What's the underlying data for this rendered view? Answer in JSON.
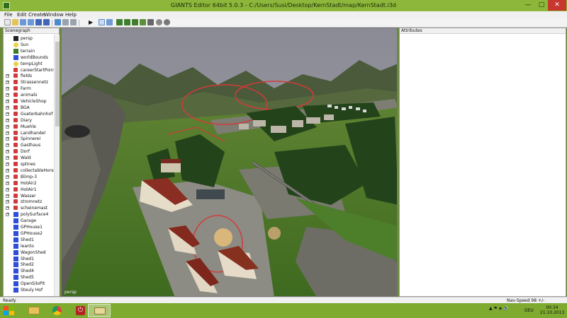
{
  "window": {
    "title": "GIANTS Editor 64bit 5.0.3 - C:/Users/Susi/Desktop/KernStadt/map/KernStadt.i3d",
    "minimize": "—",
    "maximize": "□",
    "close": "✕"
  },
  "menu": [
    "File",
    "Edit",
    "Create",
    "Window",
    "Help"
  ],
  "toolbar": {
    "icons": [
      "new-icon",
      "open-icon",
      "import-icon",
      "export-icon",
      "save-icon",
      "save-as-icon",
      "undo-icon",
      "redo-icon",
      "play-icon",
      "select-icon",
      "move-icon",
      "terrain-sculpt-icon",
      "terrain-paint-icon",
      "foliage-paint-icon",
      "cut-icon",
      "settings-icon",
      "camera-icon"
    ]
  },
  "scenegraph": {
    "title": "Scenegraph",
    "items": [
      {
        "label": "persp",
        "icon": "camera-icon",
        "expandable": false,
        "color": "#222222"
      },
      {
        "label": "Sun",
        "icon": "light-icon",
        "expandable": false,
        "color": "#e8d24a"
      },
      {
        "label": "terrain",
        "icon": "terrain-icon",
        "expandable": false,
        "color": "#3d7a2a"
      },
      {
        "label": "worldBounds",
        "icon": "shape-icon",
        "expandable": false,
        "color": "#2d4ed8"
      },
      {
        "label": "tempLight",
        "icon": "light-icon",
        "expandable": false,
        "color": "#e8d24a"
      },
      {
        "label": "careerStartPoint",
        "icon": "transform-icon",
        "expandable": false,
        "color": "#d23a3a"
      },
      {
        "label": "fields",
        "icon": "transform-icon",
        "expandable": true,
        "color": "#d23a3a"
      },
      {
        "label": "Strassennetz",
        "icon": "transform-icon",
        "expandable": true,
        "color": "#d23a3a"
      },
      {
        "label": "Farm",
        "icon": "transform-icon",
        "expandable": true,
        "color": "#d23a3a"
      },
      {
        "label": "animals",
        "icon": "transform-icon",
        "expandable": true,
        "color": "#d23a3a"
      },
      {
        "label": "VehicleShop",
        "icon": "transform-icon",
        "expandable": true,
        "color": "#d23a3a"
      },
      {
        "label": "BGA",
        "icon": "transform-icon",
        "expandable": true,
        "color": "#d23a3a"
      },
      {
        "label": "Gueterbahnhof",
        "icon": "transform-icon",
        "expandable": true,
        "color": "#d23a3a"
      },
      {
        "label": "Diary",
        "icon": "transform-icon",
        "expandable": true,
        "color": "#d23a3a"
      },
      {
        "label": "Muehle",
        "icon": "transform-icon",
        "expandable": true,
        "color": "#d23a3a"
      },
      {
        "label": "Landhandel",
        "icon": "transform-icon",
        "expandable": true,
        "color": "#d23a3a"
      },
      {
        "label": "Spinnerei",
        "icon": "transform-icon",
        "expandable": true,
        "color": "#d23a3a"
      },
      {
        "label": "Gasthaus",
        "icon": "transform-icon",
        "expandable": true,
        "color": "#d23a3a"
      },
      {
        "label": "Dorf",
        "icon": "transform-icon",
        "expandable": true,
        "color": "#d23a3a"
      },
      {
        "label": "Wald",
        "icon": "transform-icon",
        "expandable": true,
        "color": "#d23a3a"
      },
      {
        "label": "splines",
        "icon": "transform-icon",
        "expandable": true,
        "color": "#d23a3a"
      },
      {
        "label": "collectableHorses",
        "icon": "transform-icon",
        "expandable": true,
        "color": "#d23a3a"
      },
      {
        "label": "Blimp-3",
        "icon": "transform-icon",
        "expandable": true,
        "color": "#d23a3a"
      },
      {
        "label": "HotAir2",
        "icon": "transform-icon",
        "expandable": true,
        "color": "#d23a3a"
      },
      {
        "label": "HotAir1",
        "icon": "transform-icon",
        "expandable": true,
        "color": "#d23a3a"
      },
      {
        "label": "Wasser",
        "icon": "transform-icon",
        "expandable": true,
        "color": "#d23a3a"
      },
      {
        "label": "stromnetz",
        "icon": "transform-icon",
        "expandable": true,
        "color": "#d23a3a"
      },
      {
        "label": "scheinemast",
        "icon": "transform-icon",
        "expandable": true,
        "color": "#d23a3a"
      },
      {
        "label": "polySurface4",
        "icon": "shape-icon",
        "expandable": true,
        "color": "#2d4ed8"
      },
      {
        "label": "Garage",
        "icon": "shape-icon",
        "expandable": false,
        "color": "#2d4ed8"
      },
      {
        "label": "GPHouse1",
        "icon": "shape-icon",
        "expandable": false,
        "color": "#2d4ed8"
      },
      {
        "label": "GPHouse2",
        "icon": "shape-icon",
        "expandable": false,
        "color": "#2d4ed8"
      },
      {
        "label": "Shed1",
        "icon": "shape-icon",
        "expandable": false,
        "color": "#2d4ed8"
      },
      {
        "label": "leanto",
        "icon": "shape-icon",
        "expandable": false,
        "color": "#2d4ed8"
      },
      {
        "label": "WagonShed",
        "icon": "shape-icon",
        "expandable": false,
        "color": "#2d4ed8"
      },
      {
        "label": "Shed1",
        "icon": "shape-icon",
        "expandable": false,
        "color": "#2d4ed8"
      },
      {
        "label": "Shed2",
        "icon": "shape-icon",
        "expandable": false,
        "color": "#2d4ed8"
      },
      {
        "label": "Shed4",
        "icon": "shape-icon",
        "expandable": false,
        "color": "#2d4ed8"
      },
      {
        "label": "Shed5",
        "icon": "shape-icon",
        "expandable": false,
        "color": "#2d4ed8"
      },
      {
        "label": "OpenSiloPit",
        "icon": "shape-icon",
        "expandable": false,
        "color": "#2d4ed8"
      },
      {
        "label": "Steuly Hof",
        "icon": "shape-icon",
        "expandable": false,
        "color": "#2d4ed8"
      }
    ]
  },
  "viewport": {
    "camera": "persp"
  },
  "attributes": {
    "title": "Attributes"
  },
  "status": {
    "left": "Ready",
    "right": "Nav-Speed 98 +/-"
  },
  "taskbar": {
    "apps": [
      "start-icon",
      "explorer-icon",
      "chrome-icon",
      "power-app-icon",
      "giants-editor-icon"
    ],
    "lang": "DEU",
    "time": "00:34",
    "date": "21.10.2013"
  },
  "colors": {
    "titlebar": "#8db73a",
    "taskbar": "#7eab2f",
    "close": "#c7372f"
  }
}
